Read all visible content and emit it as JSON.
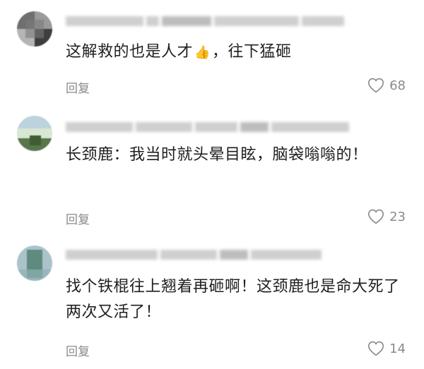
{
  "comments": [
    {
      "text": "这解救的也是人才",
      "text_suffix": "，往下猛砸",
      "emoji": "👍",
      "reply_label": "回复",
      "likes": "68"
    },
    {
      "text": "长颈鹿：我当时就头晕目眩，脑袋嗡嗡的！",
      "reply_label": "回复",
      "likes": "23"
    },
    {
      "text": "找个铁棍往上翘着再砸啊！这颈鹿也是命大死了两次又活了！",
      "reply_label": "回复",
      "likes": "14"
    }
  ]
}
